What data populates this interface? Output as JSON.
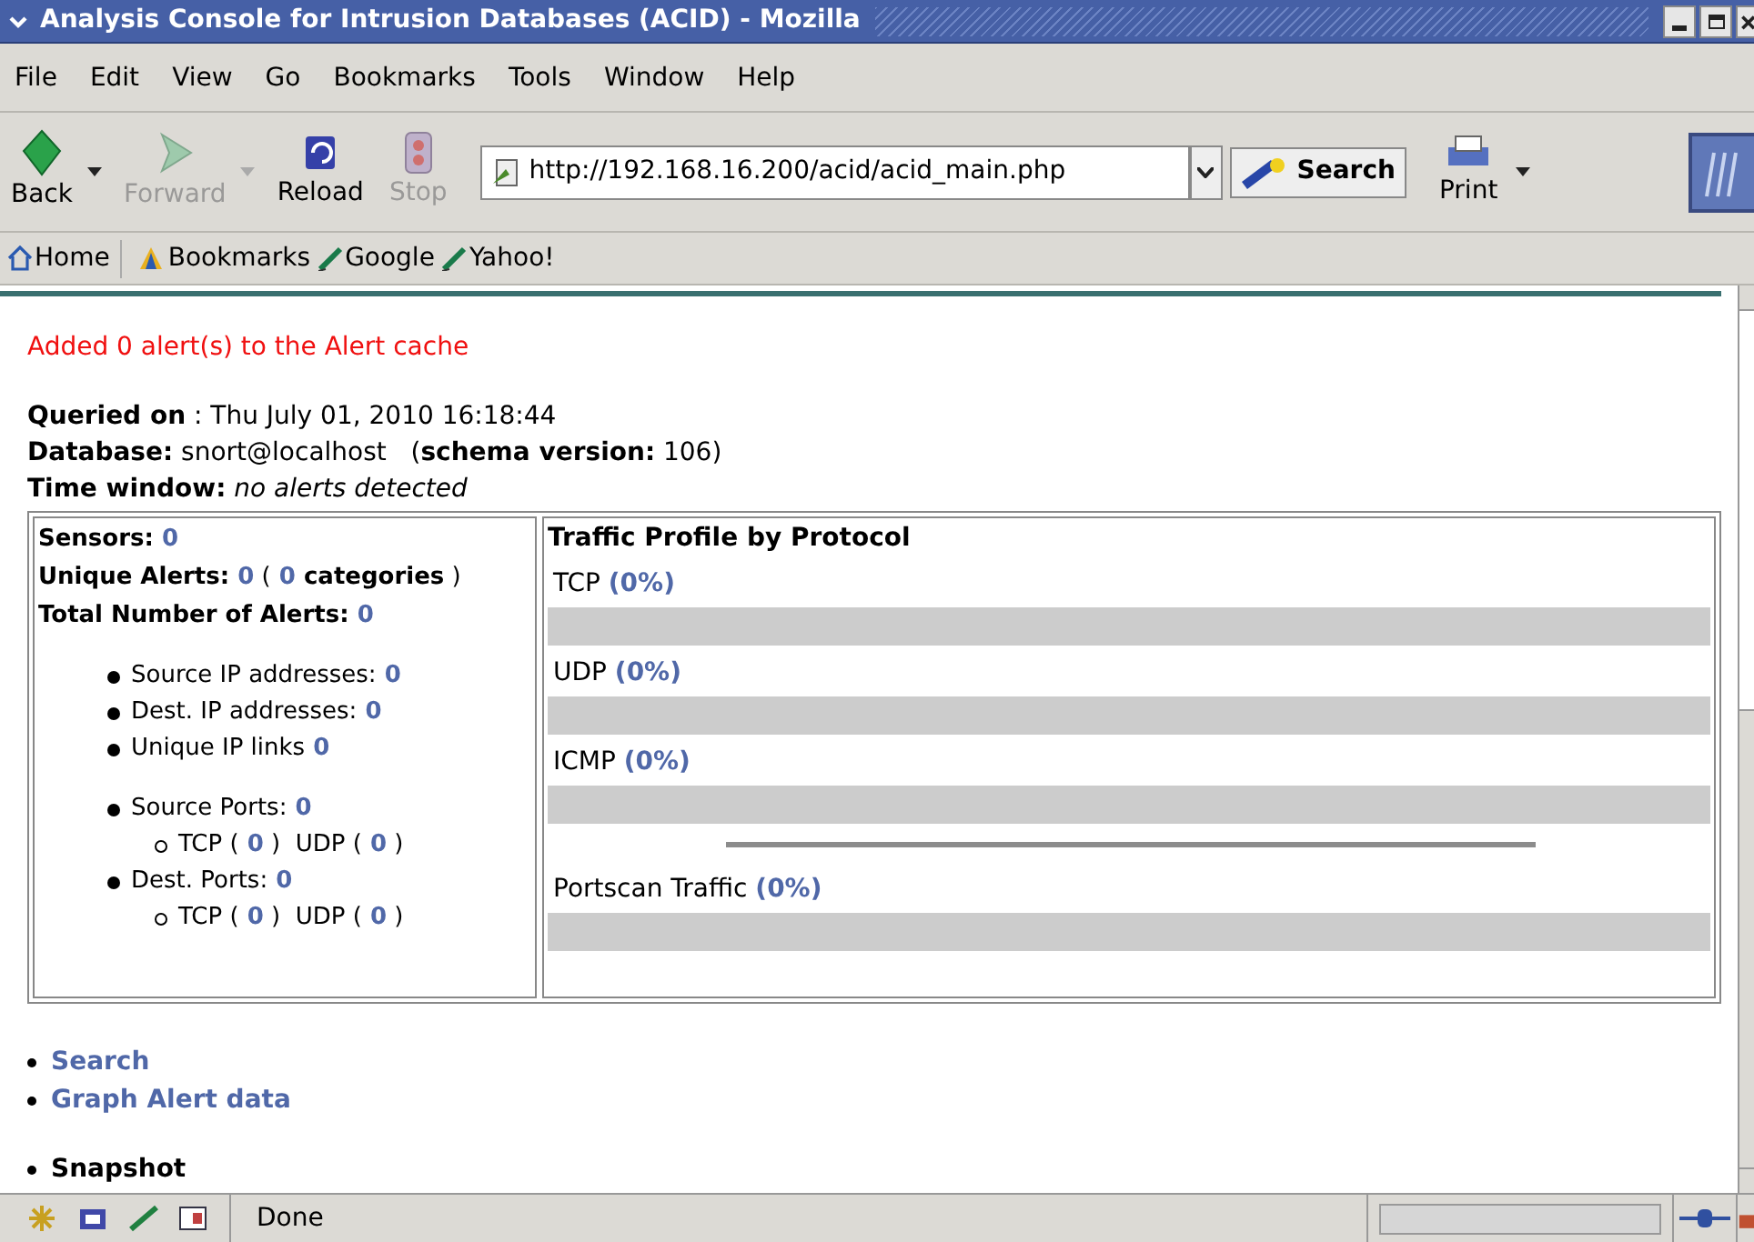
{
  "window": {
    "title": "Analysis Console for Intrusion Databases (ACID) - Mozilla"
  },
  "menu": [
    "File",
    "Edit",
    "View",
    "Go",
    "Bookmarks",
    "Tools",
    "Window",
    "Help"
  ],
  "toolbar": [
    {
      "label": "Back",
      "kind": "back",
      "disabled": false,
      "has_menu": true
    },
    {
      "label": "Forward",
      "kind": "forward",
      "disabled": true,
      "has_menu": true
    },
    {
      "label": "Reload",
      "kind": "reload",
      "disabled": false,
      "has_menu": false
    },
    {
      "label": "Stop",
      "kind": "stop",
      "disabled": true,
      "has_menu": false
    }
  ],
  "address": {
    "url": "http://192.168.16.200/acid/acid_main.php"
  },
  "search_button": "Search",
  "print_button": "Print",
  "bookmarks": [
    {
      "label": "Home",
      "kind": "home"
    },
    {
      "label": "Bookmarks",
      "kind": "folder"
    },
    {
      "label": "Google",
      "kind": "link"
    },
    {
      "label": "Yahoo!",
      "kind": "link"
    }
  ],
  "page": {
    "message": "Added 0 alert(s) to the Alert cache",
    "info": [
      "**Queried on** : Thu July 01, 2010 16:18:44",
      "**Database:** snort@localhost   (**schema version:** 106)",
      "**Time window:** *no alerts detected*"
    ],
    "summary": [
      [
        {
          "text": "Sensors:",
          "kind": "label"
        },
        {
          "text": "0",
          "kind": "value"
        }
      ],
      [
        {
          "text": "Unique Alerts:",
          "kind": "label"
        },
        {
          "text": "0",
          "kind": "value"
        },
        {
          "text": "(",
          "kind": "plain"
        },
        {
          "text": "0",
          "kind": "value"
        },
        {
          "text": "categories",
          "kind": "label"
        },
        {
          "text": ")",
          "kind": "plain"
        }
      ],
      [
        {
          "text": "Total Number of Alerts:",
          "kind": "label"
        },
        {
          "text": "0",
          "kind": "value"
        }
      ]
    ],
    "groups": [
      [
        {
          "parts": [
            {
              "text": "Source IP addresses:",
              "kind": "plain"
            },
            {
              "text": "0",
              "kind": "value"
            }
          ]
        },
        {
          "parts": [
            {
              "text": "Dest. IP addresses:",
              "kind": "plain"
            },
            {
              "text": "0",
              "kind": "value"
            }
          ]
        },
        {
          "parts": [
            {
              "text": "Unique IP links",
              "kind": "plain"
            },
            {
              "text": "0",
              "kind": "value"
            }
          ]
        }
      ],
      [
        {
          "parts": [
            {
              "text": "Source Ports:",
              "kind": "plain"
            },
            {
              "text": "0",
              "kind": "value"
            }
          ],
          "children": [
            [
              {
                "text": "TCP (",
                "kind": "plain"
              },
              {
                "text": "0",
                "kind": "value"
              },
              {
                "text": ")  UDP (",
                "kind": "plain"
              },
              {
                "text": "0",
                "kind": "value"
              },
              {
                "text": ")",
                "kind": "plain"
              }
            ]
          ]
        },
        {
          "parts": [
            {
              "text": "Dest. Ports:",
              "kind": "plain"
            },
            {
              "text": "0",
              "kind": "value"
            }
          ],
          "children": [
            [
              {
                "text": "TCP (",
                "kind": "plain"
              },
              {
                "text": "0",
                "kind": "value"
              },
              {
                "text": ")  UDP (",
                "kind": "plain"
              },
              {
                "text": "0",
                "kind": "value"
              },
              {
                "text": ")",
                "kind": "plain"
              }
            ]
          ]
        }
      ]
    ],
    "traffic": {
      "title": "Traffic Profile by Protocol",
      "protocols": [
        {
          "label": "TCP",
          "percent": "(0%)",
          "level": 0
        },
        {
          "label": "UDP",
          "percent": "(0%)",
          "level": 0
        },
        {
          "label": "ICMP",
          "percent": "(0%)",
          "level": 0
        }
      ],
      "portscan": {
        "label": "Portscan Traffic",
        "percent": "(0%)",
        "level": 0
      }
    },
    "links": [
      {
        "label": "Search",
        "link": true
      },
      {
        "label": "Graph Alert data",
        "link": true
      },
      {
        "label": "Snapshot",
        "link": false
      }
    ]
  },
  "status_bar": {
    "text": "Done"
  }
}
